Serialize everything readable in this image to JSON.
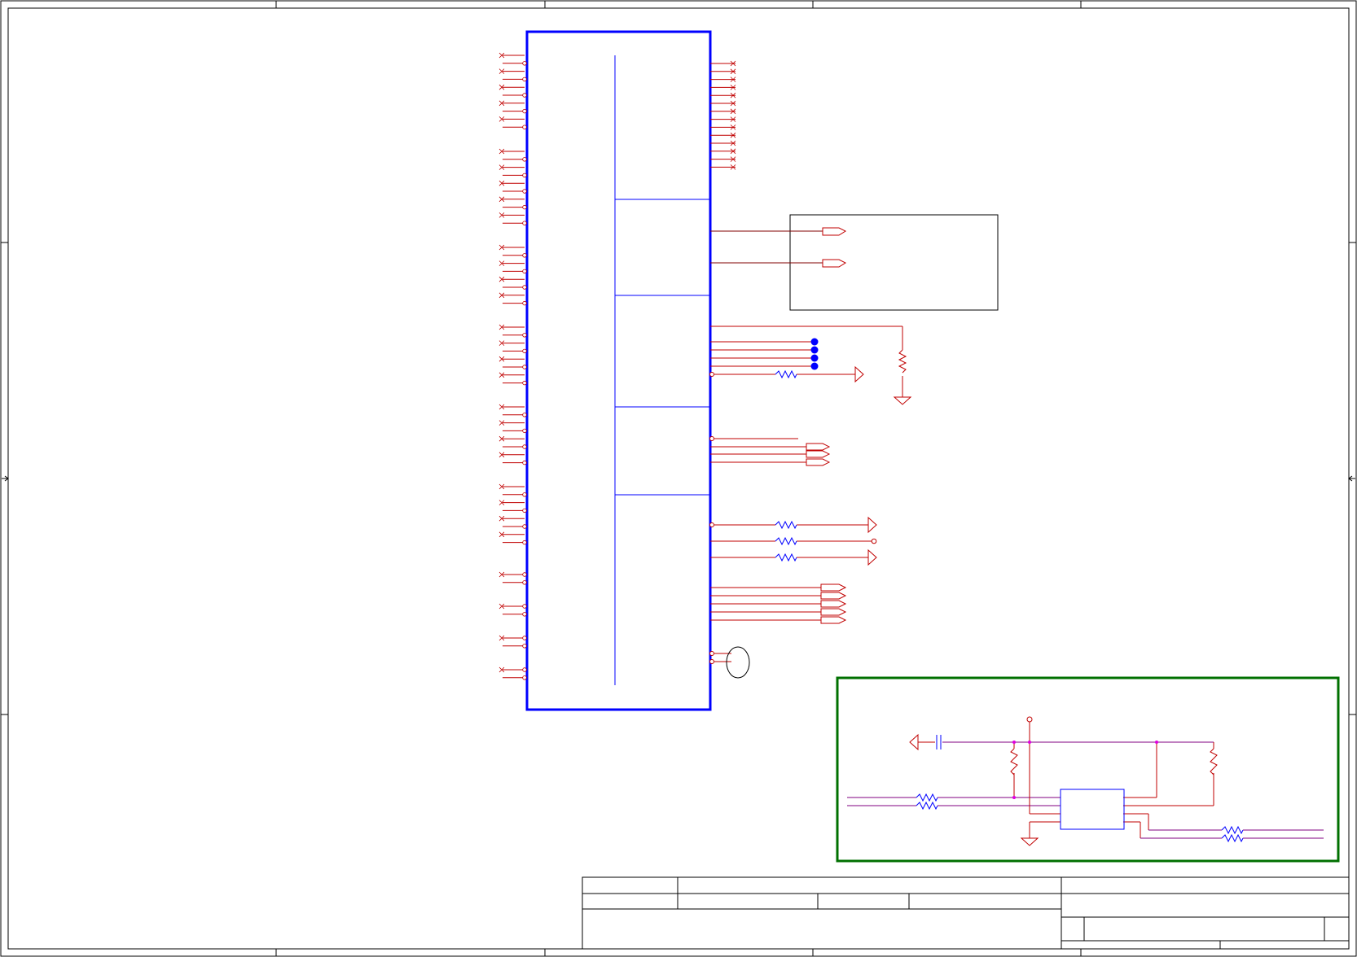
{
  "sheet": {
    "background": "#ffffff",
    "border_color": "#000000",
    "wire_color": "#c00000",
    "symbol_color": "#0000ff",
    "marker_color": "#e000e0",
    "group_color": "#007000",
    "title_block_text": []
  },
  "components": [
    {
      "kind": "ic",
      "name": "main-ic"
    },
    {
      "kind": "sub-block",
      "name": "io-buffer-block"
    },
    {
      "kind": "sub-block",
      "name": "reset-circuit-block"
    },
    {
      "kind": "ic",
      "name": "reset-ic"
    }
  ]
}
